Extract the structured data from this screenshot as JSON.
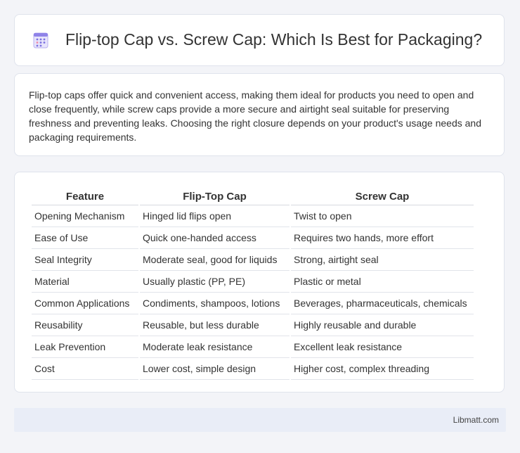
{
  "header": {
    "title": "Flip-top Cap vs. Screw Cap: Which Is Best for Packaging?",
    "icon": "calendar-grid-icon"
  },
  "intro": {
    "text": "Flip-top caps offer quick and convenient access, making them ideal for products you need to open and close frequently, while screw caps provide a more secure and airtight seal suitable for preserving freshness and preventing leaks. Choosing the right closure depends on your product's usage needs and packaging requirements."
  },
  "table": {
    "headers": [
      "Feature",
      "Flip-Top Cap",
      "Screw Cap"
    ],
    "rows": [
      [
        "Opening Mechanism",
        "Hinged lid flips open",
        "Twist to open"
      ],
      [
        "Ease of Use",
        "Quick one-handed access",
        "Requires two hands, more effort"
      ],
      [
        "Seal Integrity",
        "Moderate seal, good for liquids",
        "Strong, airtight seal"
      ],
      [
        "Material",
        "Usually plastic (PP, PE)",
        "Plastic or metal"
      ],
      [
        "Common Applications",
        "Condiments, shampoos, lotions",
        "Beverages, pharmaceuticals, chemicals"
      ],
      [
        "Reusability",
        "Reusable, but less durable",
        "Highly reusable and durable"
      ],
      [
        "Leak Prevention",
        "Moderate leak resistance",
        "Excellent leak resistance"
      ],
      [
        "Cost",
        "Lower cost, simple design",
        "Higher cost, complex threading"
      ]
    ]
  },
  "footer": {
    "site": "Libmatt.com"
  }
}
